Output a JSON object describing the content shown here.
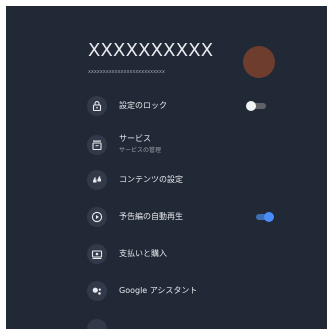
{
  "colors": {
    "panel_bg": "#212836",
    "icon_circle_bg": "#323a49",
    "text_primary": "#e8eaed",
    "text_secondary": "#9aa0a6",
    "avatar": "#6f3d2e",
    "toggle_on": "#4a8df8"
  },
  "account": {
    "name": "XXXXXXXXXX",
    "email": "xxxxxxxxxxxxxxxxxxxxxxxxxx"
  },
  "menu": [
    {
      "icon": "lock-icon",
      "label": "設定のロック",
      "toggle": "off"
    },
    {
      "icon": "services-icon",
      "label": "サービス",
      "sublabel": "サービスの管理"
    },
    {
      "icon": "content-settings-icon",
      "label": "コンテンツの設定"
    },
    {
      "icon": "play-circle-icon",
      "label": "予告編の自動再生",
      "toggle": "on"
    },
    {
      "icon": "payment-icon",
      "label": "支払いと購入"
    },
    {
      "icon": "google-assistant-icon",
      "label": "Google アシスタント"
    }
  ]
}
